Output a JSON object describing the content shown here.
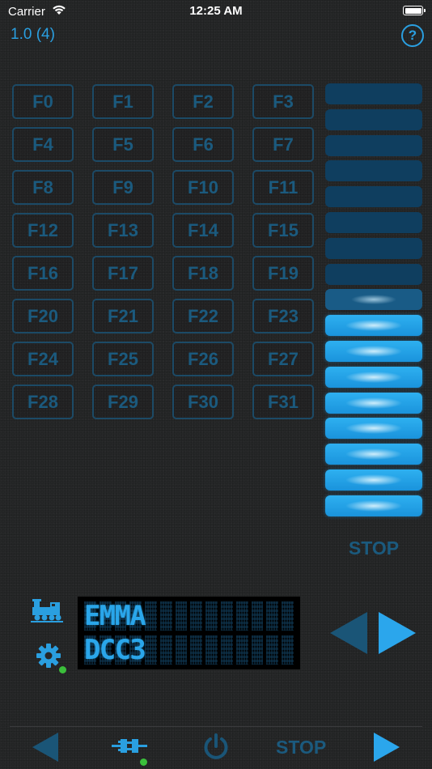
{
  "status_bar": {
    "carrier": "Carrier",
    "time": "12:25 AM"
  },
  "header": {
    "version": "1.0 (4)",
    "help_label": "?"
  },
  "function_buttons": [
    "F0",
    "F1",
    "F2",
    "F3",
    "F4",
    "F5",
    "F6",
    "F7",
    "F8",
    "F9",
    "F10",
    "F11",
    "F12",
    "F13",
    "F14",
    "F15",
    "F16",
    "F17",
    "F18",
    "F19",
    "F20",
    "F21",
    "F22",
    "F23",
    "F24",
    "F25",
    "F26",
    "F27",
    "F28",
    "F29",
    "F30",
    "F31"
  ],
  "speed": {
    "segments_total": 17,
    "segments_lit": 8,
    "has_partial_segment": true,
    "stop_label": "STOP"
  },
  "display": {
    "line1": "EMMA",
    "line2": "DCC3",
    "cells_per_line": 14
  },
  "toolbar": {
    "stop_label": "STOP"
  },
  "colors": {
    "accent": "#2a9fe0",
    "dim": "#1b5a7e",
    "active_segment": "#1fa0e6",
    "connection_dot": "#3bbf3b"
  },
  "icons": [
    "wifi-icon",
    "battery-icon",
    "help-icon",
    "locomotive-icon",
    "settings-icon",
    "direction-left-icon",
    "direction-right-icon",
    "connection-icon",
    "power-icon"
  ]
}
